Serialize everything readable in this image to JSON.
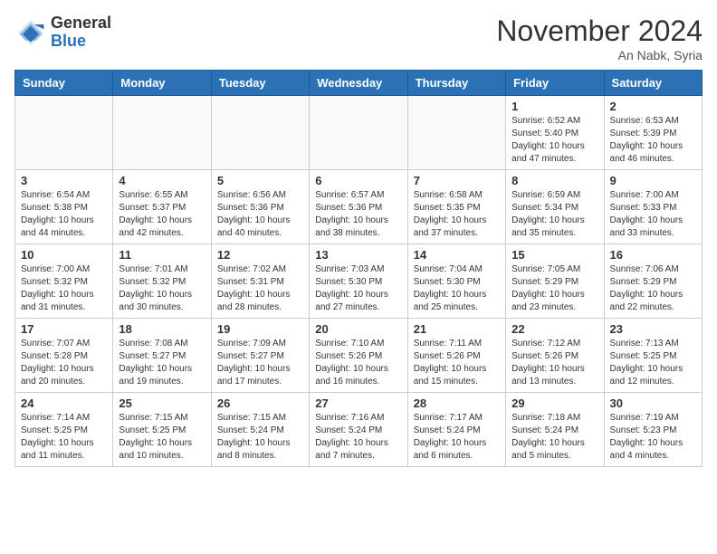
{
  "header": {
    "logo_general": "General",
    "logo_blue": "Blue",
    "month_title": "November 2024",
    "location": "An Nabk, Syria"
  },
  "weekdays": [
    "Sunday",
    "Monday",
    "Tuesday",
    "Wednesday",
    "Thursday",
    "Friday",
    "Saturday"
  ],
  "weeks": [
    [
      {
        "day": "",
        "info": ""
      },
      {
        "day": "",
        "info": ""
      },
      {
        "day": "",
        "info": ""
      },
      {
        "day": "",
        "info": ""
      },
      {
        "day": "",
        "info": ""
      },
      {
        "day": "1",
        "info": "Sunrise: 6:52 AM\nSunset: 5:40 PM\nDaylight: 10 hours and 47 minutes."
      },
      {
        "day": "2",
        "info": "Sunrise: 6:53 AM\nSunset: 5:39 PM\nDaylight: 10 hours and 46 minutes."
      }
    ],
    [
      {
        "day": "3",
        "info": "Sunrise: 6:54 AM\nSunset: 5:38 PM\nDaylight: 10 hours and 44 minutes."
      },
      {
        "day": "4",
        "info": "Sunrise: 6:55 AM\nSunset: 5:37 PM\nDaylight: 10 hours and 42 minutes."
      },
      {
        "day": "5",
        "info": "Sunrise: 6:56 AM\nSunset: 5:36 PM\nDaylight: 10 hours and 40 minutes."
      },
      {
        "day": "6",
        "info": "Sunrise: 6:57 AM\nSunset: 5:36 PM\nDaylight: 10 hours and 38 minutes."
      },
      {
        "day": "7",
        "info": "Sunrise: 6:58 AM\nSunset: 5:35 PM\nDaylight: 10 hours and 37 minutes."
      },
      {
        "day": "8",
        "info": "Sunrise: 6:59 AM\nSunset: 5:34 PM\nDaylight: 10 hours and 35 minutes."
      },
      {
        "day": "9",
        "info": "Sunrise: 7:00 AM\nSunset: 5:33 PM\nDaylight: 10 hours and 33 minutes."
      }
    ],
    [
      {
        "day": "10",
        "info": "Sunrise: 7:00 AM\nSunset: 5:32 PM\nDaylight: 10 hours and 31 minutes."
      },
      {
        "day": "11",
        "info": "Sunrise: 7:01 AM\nSunset: 5:32 PM\nDaylight: 10 hours and 30 minutes."
      },
      {
        "day": "12",
        "info": "Sunrise: 7:02 AM\nSunset: 5:31 PM\nDaylight: 10 hours and 28 minutes."
      },
      {
        "day": "13",
        "info": "Sunrise: 7:03 AM\nSunset: 5:30 PM\nDaylight: 10 hours and 27 minutes."
      },
      {
        "day": "14",
        "info": "Sunrise: 7:04 AM\nSunset: 5:30 PM\nDaylight: 10 hours and 25 minutes."
      },
      {
        "day": "15",
        "info": "Sunrise: 7:05 AM\nSunset: 5:29 PM\nDaylight: 10 hours and 23 minutes."
      },
      {
        "day": "16",
        "info": "Sunrise: 7:06 AM\nSunset: 5:29 PM\nDaylight: 10 hours and 22 minutes."
      }
    ],
    [
      {
        "day": "17",
        "info": "Sunrise: 7:07 AM\nSunset: 5:28 PM\nDaylight: 10 hours and 20 minutes."
      },
      {
        "day": "18",
        "info": "Sunrise: 7:08 AM\nSunset: 5:27 PM\nDaylight: 10 hours and 19 minutes."
      },
      {
        "day": "19",
        "info": "Sunrise: 7:09 AM\nSunset: 5:27 PM\nDaylight: 10 hours and 17 minutes."
      },
      {
        "day": "20",
        "info": "Sunrise: 7:10 AM\nSunset: 5:26 PM\nDaylight: 10 hours and 16 minutes."
      },
      {
        "day": "21",
        "info": "Sunrise: 7:11 AM\nSunset: 5:26 PM\nDaylight: 10 hours and 15 minutes."
      },
      {
        "day": "22",
        "info": "Sunrise: 7:12 AM\nSunset: 5:26 PM\nDaylight: 10 hours and 13 minutes."
      },
      {
        "day": "23",
        "info": "Sunrise: 7:13 AM\nSunset: 5:25 PM\nDaylight: 10 hours and 12 minutes."
      }
    ],
    [
      {
        "day": "24",
        "info": "Sunrise: 7:14 AM\nSunset: 5:25 PM\nDaylight: 10 hours and 11 minutes."
      },
      {
        "day": "25",
        "info": "Sunrise: 7:15 AM\nSunset: 5:25 PM\nDaylight: 10 hours and 10 minutes."
      },
      {
        "day": "26",
        "info": "Sunrise: 7:15 AM\nSunset: 5:24 PM\nDaylight: 10 hours and 8 minutes."
      },
      {
        "day": "27",
        "info": "Sunrise: 7:16 AM\nSunset: 5:24 PM\nDaylight: 10 hours and 7 minutes."
      },
      {
        "day": "28",
        "info": "Sunrise: 7:17 AM\nSunset: 5:24 PM\nDaylight: 10 hours and 6 minutes."
      },
      {
        "day": "29",
        "info": "Sunrise: 7:18 AM\nSunset: 5:24 PM\nDaylight: 10 hours and 5 minutes."
      },
      {
        "day": "30",
        "info": "Sunrise: 7:19 AM\nSunset: 5:23 PM\nDaylight: 10 hours and 4 minutes."
      }
    ]
  ]
}
